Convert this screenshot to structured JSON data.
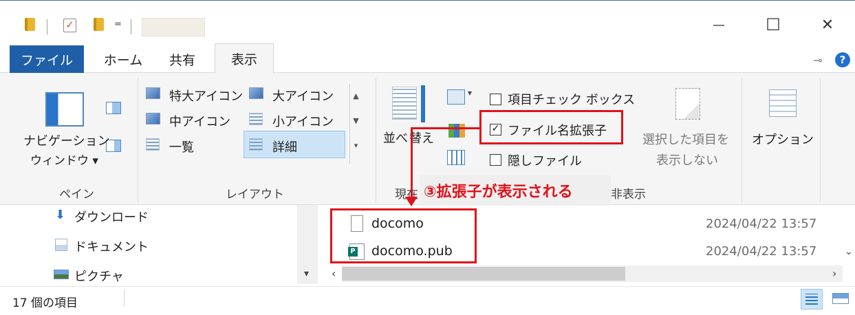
{
  "window": {
    "quick_access_dropdown": "=",
    "minimize_glyph": "—",
    "maximize_glyph": "☐",
    "close_glyph": "✕"
  },
  "tabs": [
    {
      "label": "ファイル"
    },
    {
      "label": "ホーム"
    },
    {
      "label": "共有"
    },
    {
      "label": "表示"
    }
  ],
  "ribbon": {
    "pane_group": {
      "nav_pane_line1": "ナビゲーション",
      "nav_pane_line2": "ウィンドウ ▾",
      "label": "ペイン"
    },
    "layout_group": {
      "extra_large": "特大アイコン",
      "large": "大アイコン",
      "medium": "中アイコン",
      "small": "小アイコン",
      "list": "一覧",
      "details": "詳細",
      "label": "レイアウト"
    },
    "current_view_group": {
      "sort_by_part1": "並べ",
      "sort_by_part2": "替え",
      "label_part1": "現在",
      "label_part2": "非表示"
    },
    "show_hide_group": {
      "item_checkboxes": "項目チェック ボックス",
      "file_extensions": "ファイル名拡張子",
      "hidden_items": "隠しファイル",
      "hide_selected_line1": "選択した項目を",
      "hide_selected_line2": "表示しない"
    },
    "options_label": "オプション"
  },
  "nav_pane": {
    "items": [
      {
        "label": "ダウンロード",
        "icon": "download-arrow-icon"
      },
      {
        "label": "ドキュメント",
        "icon": "document-folder-icon"
      },
      {
        "label": "ピクチャ",
        "icon": "pictures-folder-icon"
      }
    ]
  },
  "files": [
    {
      "name": "docomo",
      "date": "2024/04/22 13:57",
      "icon": "blank-file-icon"
    },
    {
      "name": "docomo.pub",
      "date": "2024/04/22 13:57",
      "icon": "publisher-file-icon"
    }
  ],
  "status": {
    "item_count": "17 個の項目"
  },
  "annotation": {
    "callout_text": "③拡張子が表示される",
    "color": "#e0121a"
  },
  "colors": {
    "file_tab": "#1f5fa8",
    "selection": "#cde4f7",
    "folder": "#e8b52e"
  }
}
